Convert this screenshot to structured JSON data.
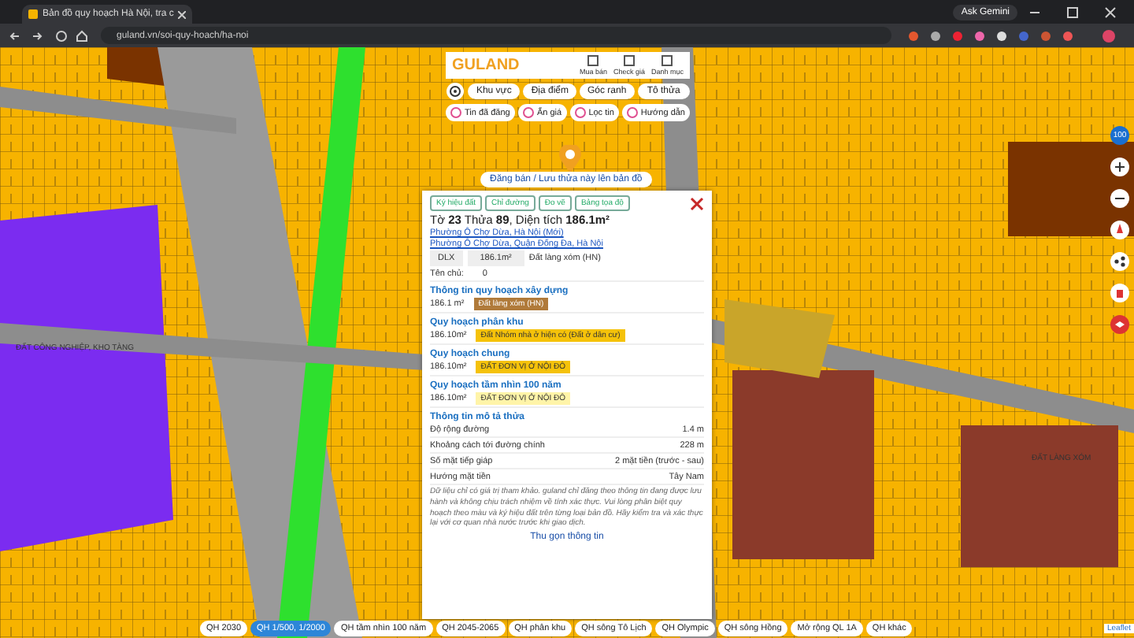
{
  "browser": {
    "tab_title": "Bản đồ quy hoạch Hà Nội, tra c",
    "url": "guland.vn/soi-quy-hoach/ha-noi",
    "gemini": "Ask Gemini"
  },
  "header": {
    "logo": "GULAND",
    "actions": [
      "Mua bán",
      "Check giá",
      "Danh mục"
    ]
  },
  "nav_buttons": [
    "Khu vực",
    "Địa điểm",
    "Góc ranh",
    "Tô thửa"
  ],
  "filter_buttons": [
    "Tin đã đăng",
    "Ẩn giá",
    "Lọc tin",
    "Hướng dẫn"
  ],
  "post_button": "Đăng bán / Lưu thửa này lên bản đồ",
  "popup": {
    "tabs": [
      "Ký hiệu đất",
      "Chỉ đường",
      "Đo vẽ",
      "Bảng tọa độ"
    ],
    "title": "Tờ **23** Thửa **89**, Diện tích **186.1m²**",
    "addresses": [
      "Phường Ô Chợ Dừa, Hà Nội (Mới)",
      "Phường Ô Chợ Dừa, Quận Đống Đa, Hà Nội"
    ],
    "land": {
      "code": "DLX",
      "area": "186.1m²",
      "name": "Đất làng xóm (HN)"
    },
    "owner_label": "Tên chủ:",
    "owner": "0",
    "sections": [
      {
        "title": "Thông tin quy hoạch xây dựng",
        "area": "186.1 m²",
        "badge": "Đất làng xóm (HN)",
        "color": "#b07a3a"
      },
      {
        "title": "Quy hoạch phân khu",
        "area": "186.10m²",
        "badge": "Đất Nhóm nhà ở hiện có (Đất ở dân cư)",
        "color": "#f5c20a"
      },
      {
        "title": "Quy hoạch chung",
        "area": "186.10m²",
        "badge": "ĐẤT ĐƠN VỊ Ở NỘI ĐÔ",
        "color": "#f5c20a"
      },
      {
        "title": "Quy hoạch tầm nhìn 100 năm",
        "area": "186.10m²",
        "badge": "ĐẤT ĐƠN VỊ Ở NỘI ĐÔ",
        "color": "#fff4a8"
      }
    ],
    "info_title": "Thông tin mô tả thửa",
    "info_rows": [
      {
        "label": "Độ rộng đường",
        "value": "1.4 m"
      },
      {
        "label": "Khoảng cách tới đường chính",
        "value": "228 m"
      },
      {
        "label": "Số mặt tiếp giáp",
        "value": "2 mặt tiền (trước - sau)"
      },
      {
        "label": "Hướng mặt tiền",
        "value": "Tây Nam"
      }
    ],
    "note": "Dữ liệu chỉ có giá trị tham khảo. guland chỉ đăng theo thông tin đang được lưu hành và không chịu trách nhiệm về tính xác thực. Vui lòng phân biệt quy hoạch theo màu và ký hiệu đất trên từng loại bản đồ. Hãy kiểm tra và xác thực lại với cơ quan nhà nước trước khi giao dịch.",
    "collapse": "Thu gọn thông tin"
  },
  "zoom_badge": "100",
  "map_labels": [
    "ĐẤT CÔNG NGHIỆP, KHO TÀNG",
    "ĐẤT LÀNG XÓM"
  ],
  "layers": [
    {
      "label": "QH 2030",
      "selected": false
    },
    {
      "label": "QH 1/500, 1/2000",
      "selected": true
    },
    {
      "label": "QH tầm nhìn 100 năm",
      "selected": false
    },
    {
      "label": "QH 2045-2065",
      "selected": false
    },
    {
      "label": "QH phân khu",
      "selected": false
    },
    {
      "label": "QH sông Tô Lịch",
      "selected": false
    },
    {
      "label": "QH Olympic",
      "selected": false
    },
    {
      "label": "QH sông Hồng",
      "selected": false
    },
    {
      "label": "Mở rộng QL 1A",
      "selected": false
    },
    {
      "label": "QH khác",
      "selected": false
    }
  ],
  "attribution": "Leaflet"
}
